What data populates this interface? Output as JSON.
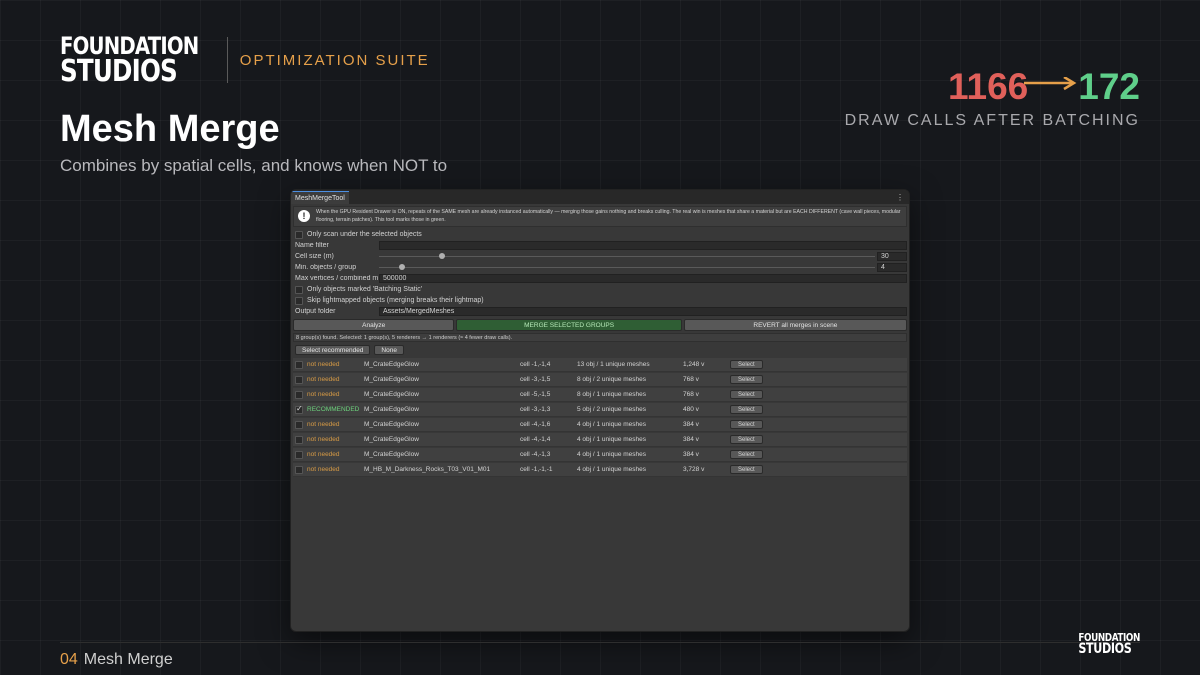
{
  "brand": {
    "logo_line1": "FOUNDATION",
    "logo_line2": "STUDIOS",
    "suite": "OPTIMIZATION SUITE"
  },
  "slide": {
    "title": "Mesh Merge",
    "subtitle": "Combines by spatial cells, and knows when NOT to",
    "footer_num": "04",
    "footer_label": "Mesh Merge"
  },
  "stat": {
    "before": "1166",
    "after": "172",
    "label": "DRAW CALLS AFTER BATCHING",
    "colors": {
      "before": "#e0605a",
      "after": "#5fcf8a",
      "arrow": "#e6a04a"
    }
  },
  "tool": {
    "tab": "MeshMergeTool",
    "help": "When the GPU Resident Drawer is ON, repeats of the SAME mesh are already instanced automatically — merging those gains nothing and breaks culling. The real win is meshes that share a material but are EACH DIFFERENT (cave wall pieces, modular flooring, terrain patches). This tool marks those in green.",
    "only_scan_label": "Only scan under the selected objects",
    "name_filter_label": "Name filter",
    "name_filter_value": "",
    "cell_size_label": "Cell size (m)",
    "cell_size_value": "30",
    "cell_size_fraction": 0.12,
    "min_objects_label": "Min. objects / group",
    "min_objects_value": "4",
    "min_objects_fraction": 0.04,
    "max_vertices_label": "Max vertices / combined m",
    "max_vertices_value": "500000",
    "batching_static_label": "Only objects marked 'Batching Static'",
    "skip_lightmapped_label": "Skip lightmapped objects (merging breaks their lightmap)",
    "output_folder_label": "Output folder",
    "output_folder_value": "Assets/MergedMeshes",
    "analyze_button": "Analyze",
    "merge_button": "MERGE SELECTED GROUPS",
    "revert_button": "REVERT all merges in scene",
    "status": "8 group(s) found. Selected: 1 group(s), 5 renderers → 1 renderers (≈ 4 fewer draw calls).",
    "select_recommended_button": "Select recommended",
    "none_button": "None",
    "select_label": "Select",
    "groups": [
      {
        "checked": false,
        "state": "not needed",
        "recommended": false,
        "material": "M_CrateEdgeGlow",
        "cell": "cell -1,-1,4",
        "objects": "13 obj / 1 unique meshes",
        "verts": "1,248 v"
      },
      {
        "checked": false,
        "state": "not needed",
        "recommended": false,
        "material": "M_CrateEdgeGlow",
        "cell": "cell -3,-1,5",
        "objects": "8 obj / 2 unique meshes",
        "verts": "768 v"
      },
      {
        "checked": false,
        "state": "not needed",
        "recommended": false,
        "material": "M_CrateEdgeGlow",
        "cell": "cell -5,-1,5",
        "objects": "8 obj / 1 unique meshes",
        "verts": "768 v"
      },
      {
        "checked": true,
        "state": "RECOMMENDED",
        "recommended": true,
        "material": "M_CrateEdgeGlow",
        "cell": "cell -3,-1,3",
        "objects": "5 obj / 2 unique meshes",
        "verts": "480 v"
      },
      {
        "checked": false,
        "state": "not needed",
        "recommended": false,
        "material": "M_CrateEdgeGlow",
        "cell": "cell -4,-1,6",
        "objects": "4 obj / 1 unique meshes",
        "verts": "384 v"
      },
      {
        "checked": false,
        "state": "not needed",
        "recommended": false,
        "material": "M_CrateEdgeGlow",
        "cell": "cell -4,-1,4",
        "objects": "4 obj / 1 unique meshes",
        "verts": "384 v"
      },
      {
        "checked": false,
        "state": "not needed",
        "recommended": false,
        "material": "M_CrateEdgeGlow",
        "cell": "cell -4,-1,3",
        "objects": "4 obj / 1 unique meshes",
        "verts": "384 v"
      },
      {
        "checked": false,
        "state": "not needed",
        "recommended": false,
        "material": "M_HB_M_Darkness_Rocks_T03_V01_M01",
        "cell": "cell -1,-1,-1",
        "objects": "4 obj / 1 unique meshes",
        "verts": "3,728 v"
      }
    ]
  }
}
